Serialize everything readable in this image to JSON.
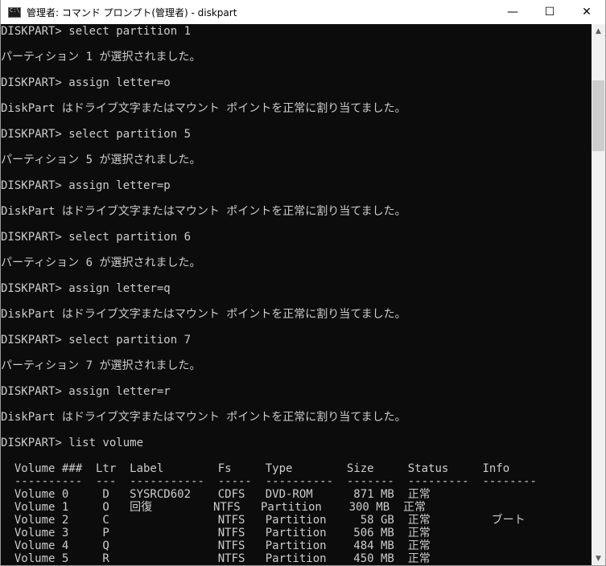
{
  "window": {
    "title": "管理者: コマンド プロンプト(管理者) - diskpart",
    "minimize_glyph": "—",
    "maximize_glyph": "☐",
    "close_glyph": "✕",
    "icon": "console-icon"
  },
  "console": {
    "lines": [
      "DISKPART> select partition 1",
      "",
      "パーティション 1 が選択されました。",
      "",
      "DISKPART> assign letter=o",
      "",
      "DiskPart はドライブ文字またはマウント ポイントを正常に割り当てました。",
      "",
      "DISKPART> select partition 5",
      "",
      "パーティション 5 が選択されました。",
      "",
      "DISKPART> assign letter=p",
      "",
      "DiskPart はドライブ文字またはマウント ポイントを正常に割り当てました。",
      "",
      "DISKPART> select partition 6",
      "",
      "パーティション 6 が選択されました。",
      "",
      "DISKPART> assign letter=q",
      "",
      "DiskPart はドライブ文字またはマウント ポイントを正常に割り当てました。",
      "",
      "DISKPART> select partition 7",
      "",
      "パーティション 7 が選択されました。",
      "",
      "DISKPART> assign letter=r",
      "",
      "DiskPart はドライブ文字またはマウント ポイントを正常に割り当てました。",
      "",
      "DISKPART> list volume",
      "",
      "  Volume ###  Ltr  Label        Fs     Type        Size     Status     Info",
      "  ----------  ---  -----------  -----  ----------  -------  ---------  --------",
      "  Volume 0     D   SYSRCD602    CDFS   DVD-ROM      871 MB  正常",
      "  Volume 1     O   回復         NTFS   Partition    300 MB  正常",
      "  Volume 2     C                NTFS   Partition     58 GB  正常         ブート",
      "  Volume 3     P                NTFS   Partition    506 MB  正常",
      "  Volume 4     Q                NTFS   Partition    484 MB  正常",
      "  Volume 5     R                NTFS   Partition    450 MB  正常"
    ]
  },
  "scrollbar": {
    "up_glyph": "▲",
    "down_glyph": "▼"
  }
}
